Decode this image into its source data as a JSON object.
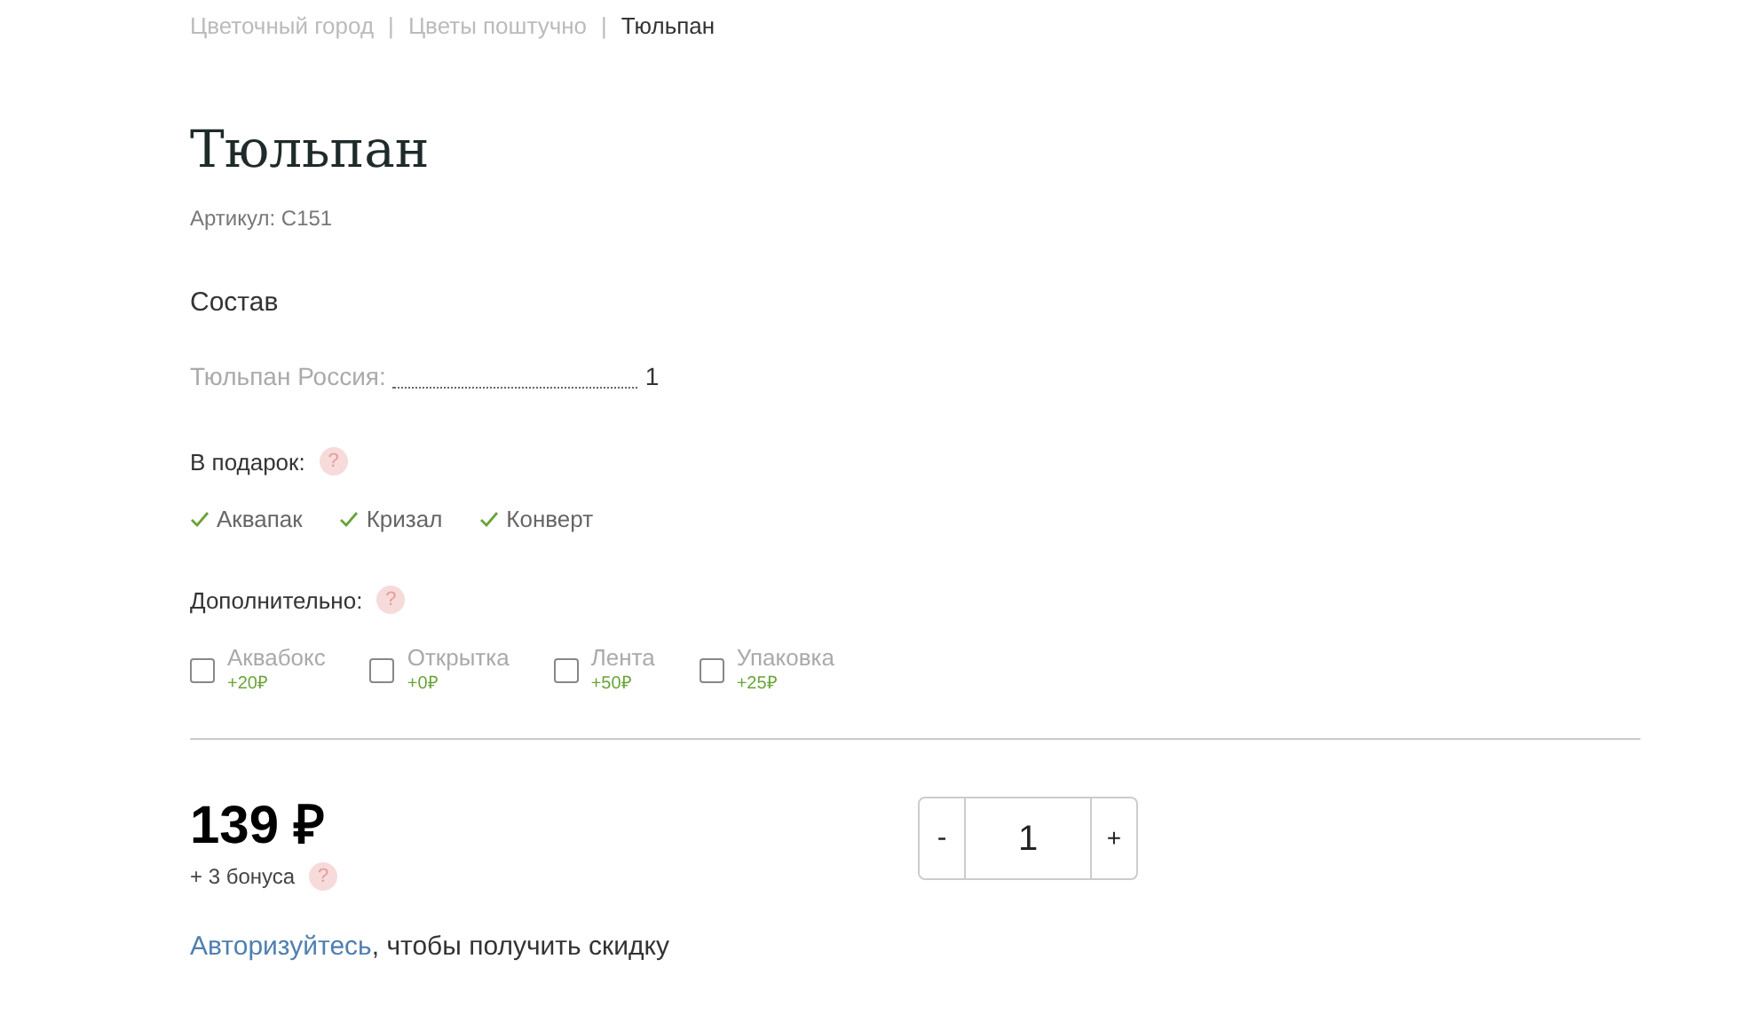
{
  "breadcrumbs": [
    {
      "label": "Цветочный город",
      "current": false
    },
    {
      "label": "Цветы поштучно",
      "current": false
    },
    {
      "label": "Тюльпан",
      "current": true
    }
  ],
  "separator": "|",
  "product": {
    "title": "Тюльпан",
    "sku": "Артикул: С151"
  },
  "composition": {
    "heading": "Состав",
    "items": [
      {
        "name": "Тюльпан Россия:",
        "count": "1"
      }
    ]
  },
  "gifts": {
    "label": "В подарок:",
    "help": "?",
    "items": [
      {
        "label": "Аквапак",
        "checked": true
      },
      {
        "label": "Кризал",
        "checked": true
      },
      {
        "label": "Конверт",
        "checked": true
      }
    ]
  },
  "extras": {
    "label": "Дополнительно:",
    "help": "?",
    "items": [
      {
        "label": "Аквабокс",
        "price": "+20₽",
        "checked": false
      },
      {
        "label": "Открытка",
        "price": "+0₽",
        "checked": false
      },
      {
        "label": "Лента",
        "price": "+50₽",
        "checked": false
      },
      {
        "label": "Упаковка",
        "price": "+25₽",
        "checked": false
      }
    ]
  },
  "price": {
    "amount": "139 ₽",
    "bonus": "+ 3 бонуса",
    "help": "?"
  },
  "quantity": {
    "minus": "-",
    "value": "1",
    "plus": "+"
  },
  "login_note": {
    "link": "Авторизуйтесь",
    "text": ", чтобы получить скидку"
  }
}
